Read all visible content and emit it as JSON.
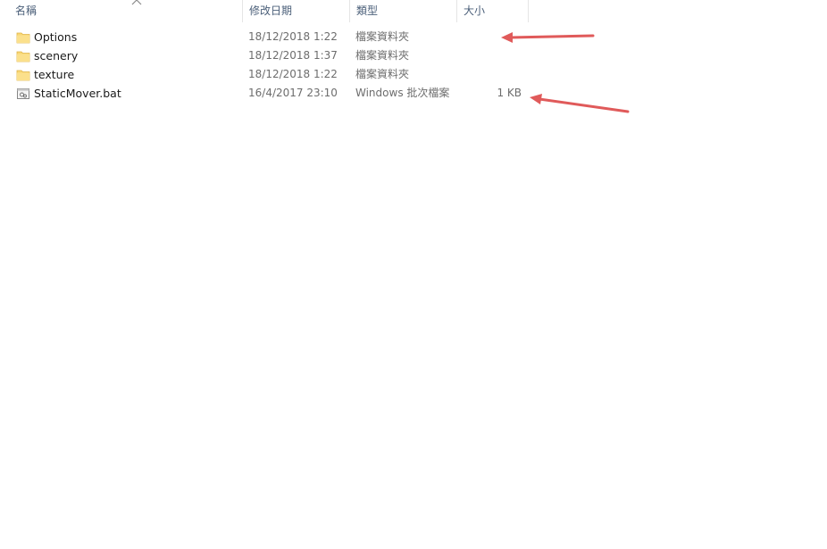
{
  "columns": {
    "name": "名稱",
    "date": "修改日期",
    "type": "類型",
    "size": "大小"
  },
  "files": [
    {
      "name": "Options",
      "date": "18/12/2018 1:22",
      "type": "檔案資料夾",
      "size": "",
      "icon": "folder-icon"
    },
    {
      "name": "scenery",
      "date": "18/12/2018 1:37",
      "type": "檔案資料夾",
      "size": "",
      "icon": "folder-icon"
    },
    {
      "name": "texture",
      "date": "18/12/2018 1:22",
      "type": "檔案資料夾",
      "size": "",
      "icon": "folder-icon"
    },
    {
      "name": "StaticMover.bat",
      "date": "16/4/2017 23:10",
      "type": "Windows 批次檔案",
      "size": "1 KB",
      "icon": "batch-file-icon"
    }
  ],
  "colors": {
    "folder": "#f8d775",
    "header_text": "#4c607a",
    "annotation_arrow": "#e05a5a"
  },
  "annotations": [
    {
      "icon": "red-arrow-icon",
      "points_to": "type column, Options row"
    },
    {
      "icon": "red-arrow-icon",
      "points_to": "size column, StaticMover.bat row"
    }
  ]
}
